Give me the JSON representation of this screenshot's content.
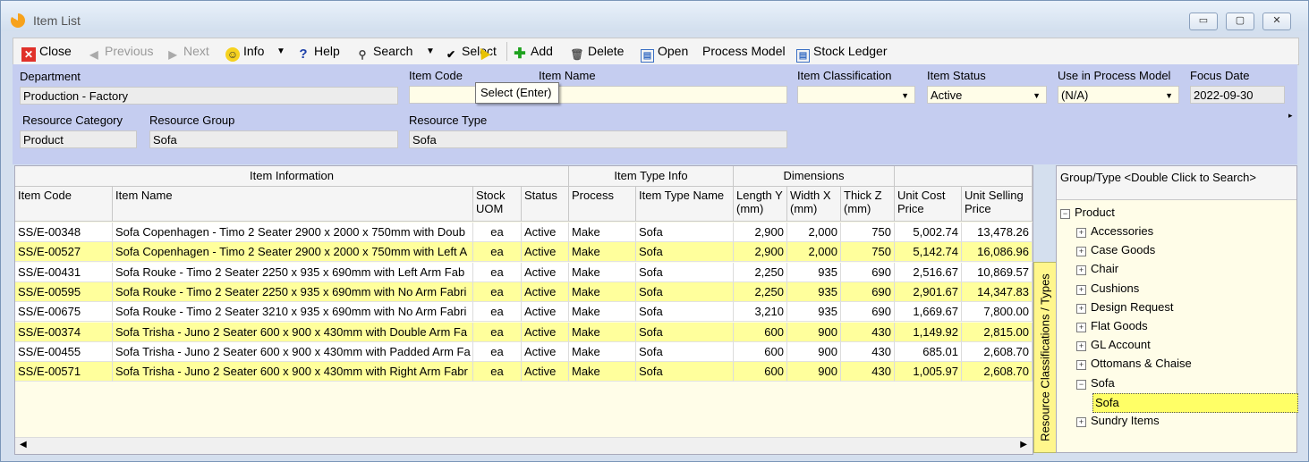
{
  "window": {
    "title": "Item List",
    "min_label": "▭",
    "max_label": "▢",
    "close_label": "✕"
  },
  "toolbar": {
    "close": "Close",
    "previous": "Previous",
    "next": "Next",
    "info": "Info",
    "help": "Help",
    "search": "Search",
    "select": "Select",
    "add": "Add",
    "delete": "Delete",
    "open": "Open",
    "process_model": "Process Model",
    "stock_ledger": "Stock Ledger"
  },
  "tooltip": "Select (Enter)",
  "filters": {
    "department_label": "Department",
    "department_value": "Production - Factory",
    "item_code_label": "Item Code",
    "item_code_value": "",
    "item_name_label": "Item Name",
    "item_name_value": "",
    "item_classification_label": "Item Classification",
    "item_classification_value": "",
    "item_status_label": "Item Status",
    "item_status_value": "Active",
    "use_in_process_label": "Use in Process Model",
    "use_in_process_value": "(N/A)",
    "focus_date_label": "Focus Date",
    "focus_date_value": "2022-09-30",
    "resource_category_label": "Resource Category",
    "resource_category_value": "Product",
    "resource_group_label": "Resource Group",
    "resource_group_value": "Sofa",
    "resource_type_label": "Resource Type",
    "resource_type_value": "Sofa"
  },
  "grid": {
    "groups": {
      "item_information": "Item Information",
      "item_type_info": "Item Type Info",
      "dimensions": "Dimensions"
    },
    "columns": {
      "item_code": "Item Code",
      "item_name": "Item Name",
      "stock_uom": "Stock UOM",
      "status": "Status",
      "process": "Process",
      "item_type_name": "Item Type Name",
      "length": "Length Y (mm)",
      "width": "Width X (mm)",
      "thick": "Thick Z (mm)",
      "unit_cost": "Unit Cost Price",
      "unit_selling": "Unit Selling Price"
    },
    "rows": [
      {
        "code": "SS/E-00348",
        "name": "Sofa Copenhagen - Timo 2 Seater 2900 x 2000 x 750mm with Doub",
        "uom": "ea",
        "status": "Active",
        "process": "Make",
        "type": "Sofa",
        "length": "2,900",
        "width": "2,000",
        "thick": "750",
        "cost": "5,002.74",
        "sell": "13,478.26"
      },
      {
        "code": "SS/E-00527",
        "name": "Sofa Copenhagen - Timo 2 Seater 2900 x 2000 x 750mm with Left A",
        "uom": "ea",
        "status": "Active",
        "process": "Make",
        "type": "Sofa",
        "length": "2,900",
        "width": "2,000",
        "thick": "750",
        "cost": "5,142.74",
        "sell": "16,086.96"
      },
      {
        "code": "SS/E-00431",
        "name": "Sofa Rouke - Timo 2 Seater 2250 x 935 x 690mm with Left Arm Fab",
        "uom": "ea",
        "status": "Active",
        "process": "Make",
        "type": "Sofa",
        "length": "2,250",
        "width": "935",
        "thick": "690",
        "cost": "2,516.67",
        "sell": "10,869.57"
      },
      {
        "code": "SS/E-00595",
        "name": "Sofa Rouke - Timo 2 Seater 2250 x 935 x 690mm with No Arm Fabri",
        "uom": "ea",
        "status": "Active",
        "process": "Make",
        "type": "Sofa",
        "length": "2,250",
        "width": "935",
        "thick": "690",
        "cost": "2,901.67",
        "sell": "14,347.83"
      },
      {
        "code": "SS/E-00675",
        "name": "Sofa Rouke - Timo 2 Seater 3210 x 935 x 690mm with No Arm Fabri",
        "uom": "ea",
        "status": "Active",
        "process": "Make",
        "type": "Sofa",
        "length": "3,210",
        "width": "935",
        "thick": "690",
        "cost": "1,669.67",
        "sell": "7,800.00"
      },
      {
        "code": "SS/E-00374",
        "name": "Sofa Trisha - Juno 2 Seater 600 x 900 x 430mm with Double Arm Fa",
        "uom": "ea",
        "status": "Active",
        "process": "Make",
        "type": "Sofa",
        "length": "600",
        "width": "900",
        "thick": "430",
        "cost": "1,149.92",
        "sell": "2,815.00"
      },
      {
        "code": "SS/E-00455",
        "name": "Sofa Trisha - Juno 2 Seater 600 x 900 x 430mm with Padded Arm Fa",
        "uom": "ea",
        "status": "Active",
        "process": "Make",
        "type": "Sofa",
        "length": "600",
        "width": "900",
        "thick": "430",
        "cost": "685.01",
        "sell": "2,608.70"
      },
      {
        "code": "SS/E-00571",
        "name": "Sofa Trisha - Juno 2 Seater 600 x 900 x 430mm with Right Arm Fabr",
        "uom": "ea",
        "status": "Active",
        "process": "Make",
        "type": "Sofa",
        "length": "600",
        "width": "900",
        "thick": "430",
        "cost": "1,005.97",
        "sell": "2,608.70"
      }
    ]
  },
  "side_tab": "Resource Classifications / Types",
  "tree": {
    "header": "Group/Type    <Double Click to Search>",
    "root": "Product",
    "items": [
      "Accessories",
      "Case Goods",
      "Chair",
      "Cushions",
      "Design Request",
      "Flat Goods",
      "GL Account",
      "Ottomans & Chaise",
      "Sofa",
      "Sofa",
      "Sundry Items"
    ]
  },
  "colors": {
    "filter_bg": "#c5cdf0",
    "row_highlight": "#ffff9c",
    "field_bg": "#fffde8"
  }
}
